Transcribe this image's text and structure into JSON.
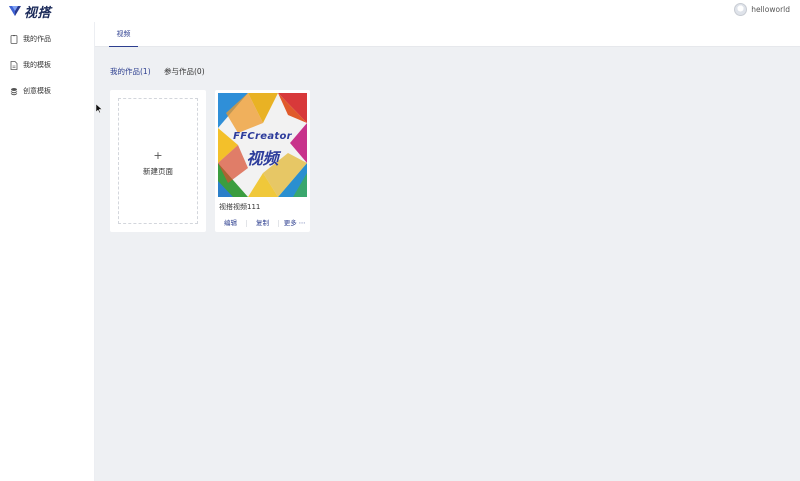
{
  "header": {
    "app_name": "视搭",
    "brand_color": "#1d2c5b",
    "user": {
      "name": "helloworld",
      "avatar_icon": "user-avatar"
    }
  },
  "sidebar": {
    "items": [
      {
        "label": "我的作品",
        "icon": "document-icon"
      },
      {
        "label": "我的模板",
        "icon": "file-icon"
      },
      {
        "label": "创意模板",
        "icon": "layers-icon"
      }
    ]
  },
  "tabs": [
    {
      "label": "视频",
      "active": true
    }
  ],
  "main": {
    "subtabs": [
      {
        "label": "我的作品(1)",
        "active": true
      },
      {
        "label": "参与作品(0)",
        "active": false
      }
    ],
    "new_card": {
      "icon": "+",
      "label": "新建页面"
    },
    "works": [
      {
        "title": "视搭视频111",
        "thumbnail": {
          "line1": "FFCreator",
          "line2": "视频"
        },
        "actions": {
          "edit": "编辑",
          "copy": "复制",
          "more": "更多 ⋯"
        }
      }
    ]
  },
  "accent_color": "#2c3e8f"
}
